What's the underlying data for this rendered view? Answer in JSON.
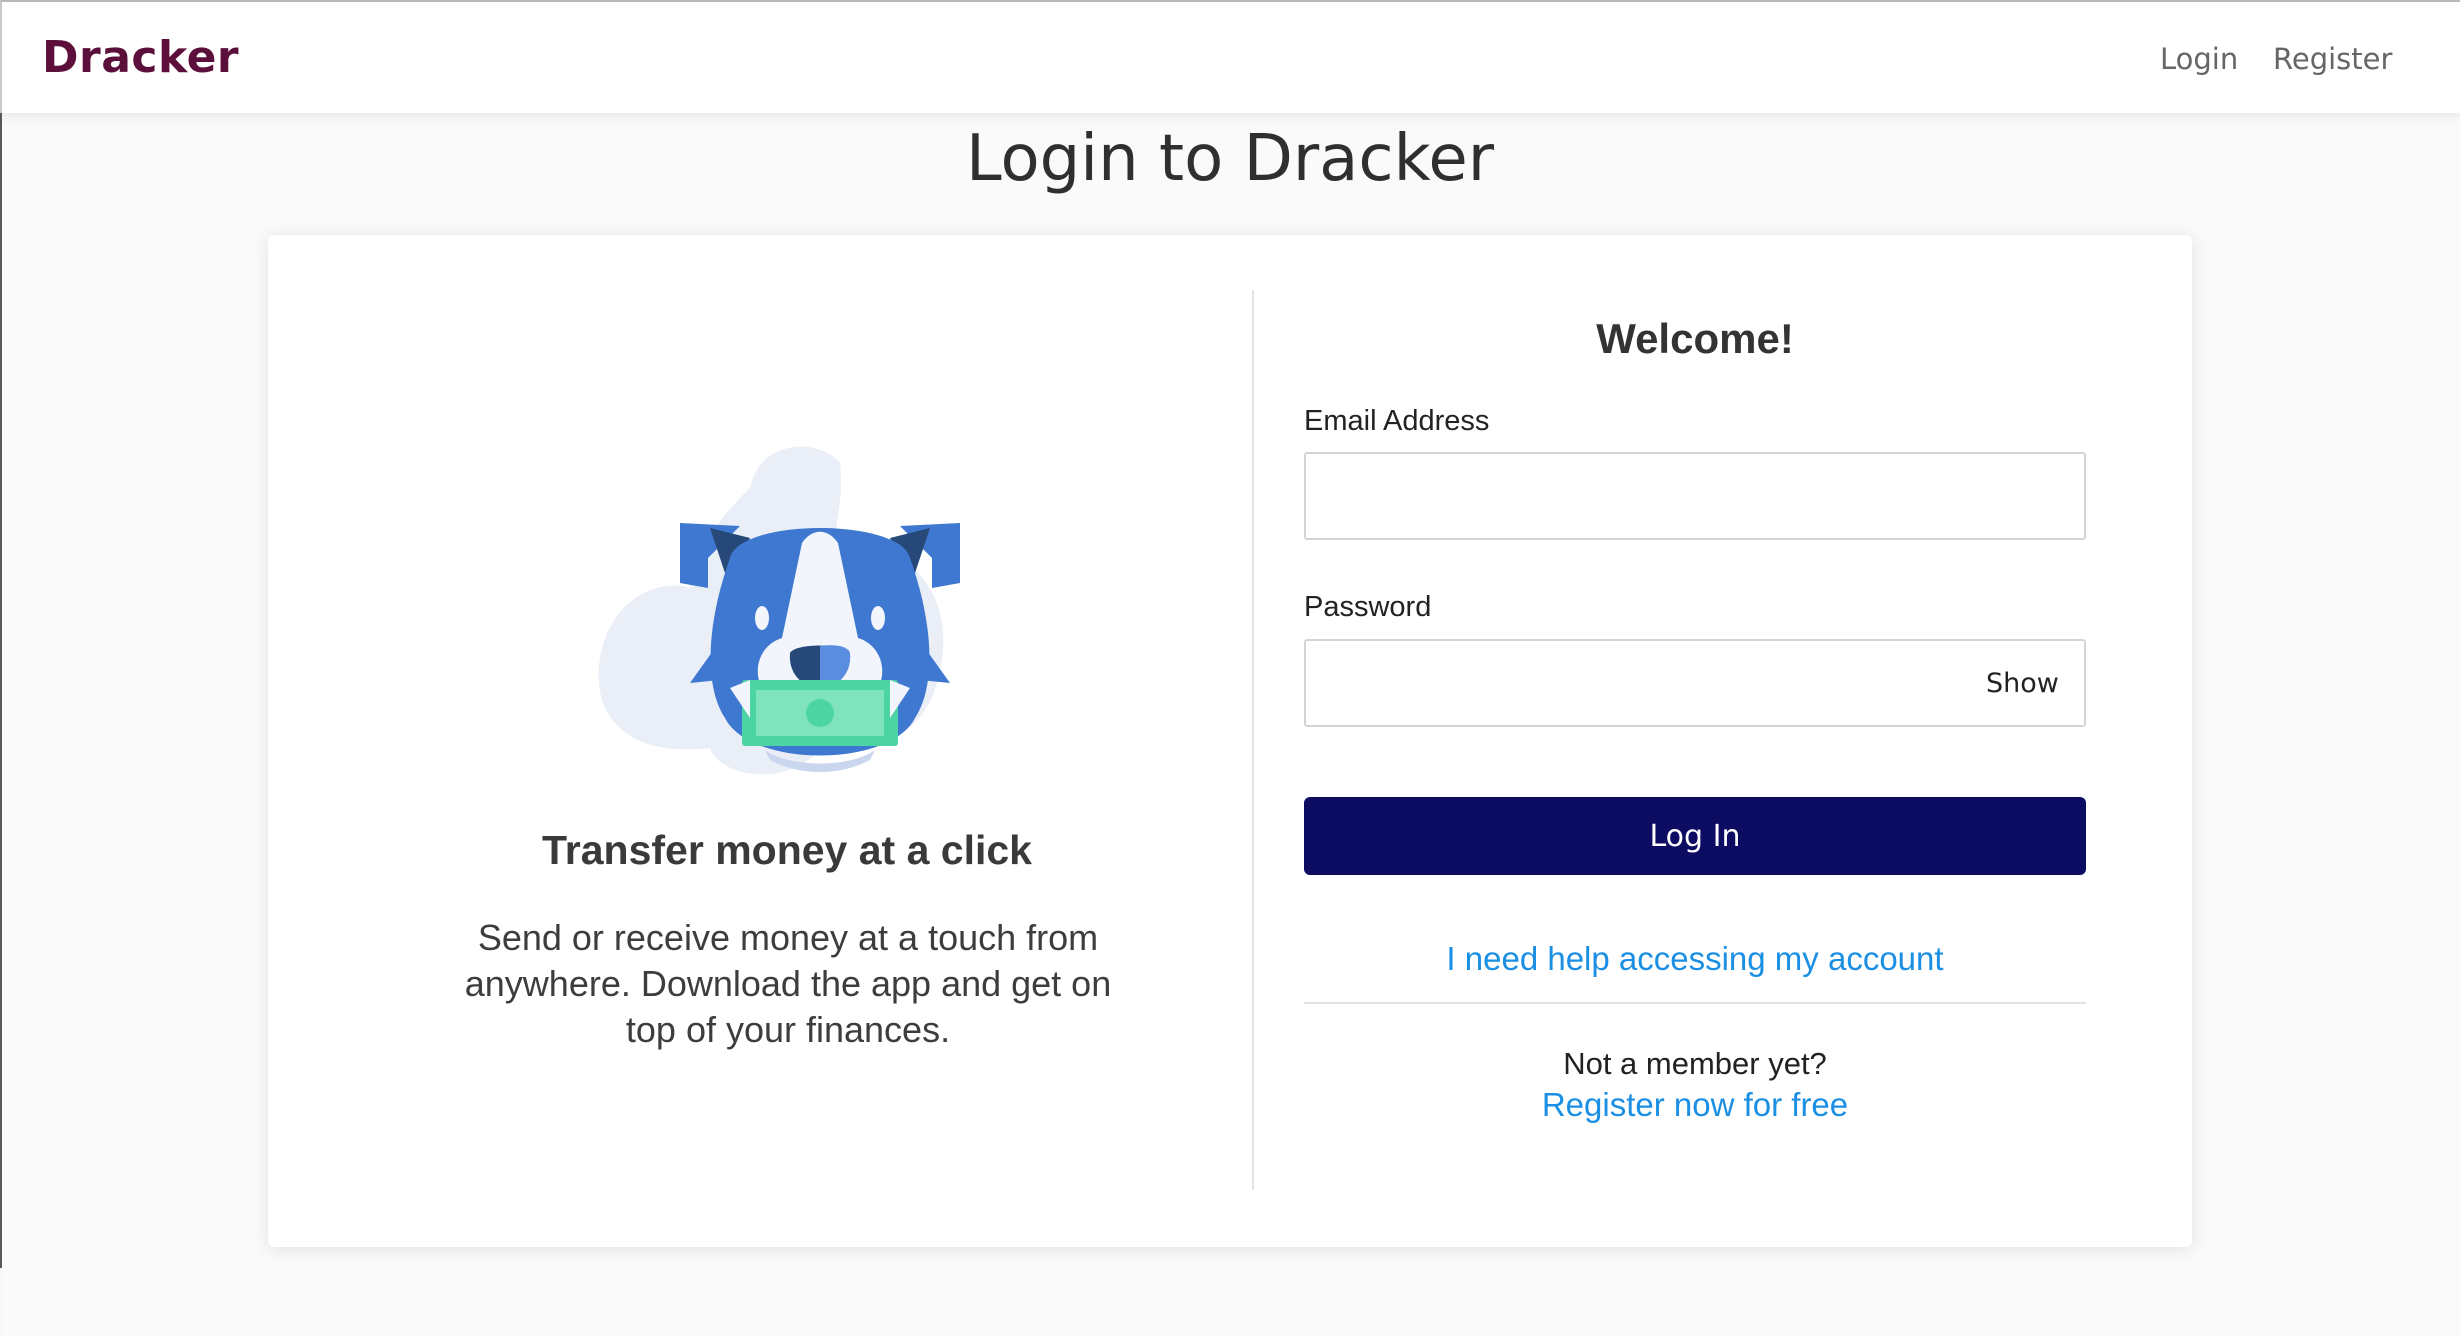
{
  "navbar": {
    "brand": "Dracker",
    "links": [
      {
        "label": "Login"
      },
      {
        "label": "Register"
      }
    ]
  },
  "page": {
    "title": "Login to Dracker"
  },
  "promo": {
    "illustration_icon": "dog-holding-money-illustration",
    "title": "Transfer money at a click",
    "text": "Send or receive money at a touch from anywhere. Download the app and get on top of your finances."
  },
  "form": {
    "welcome": "Welcome!",
    "email": {
      "label": "Email Address",
      "value": "",
      "placeholder": ""
    },
    "password": {
      "label": "Password",
      "value": "",
      "placeholder": "",
      "toggle_label": "Show"
    },
    "submit_label": "Log In",
    "help_link": "I need help accessing my account",
    "not_member": "Not a member yet?",
    "register_link": "Register now for free"
  },
  "colors": {
    "brand": "#5b0f3a",
    "primary_button": "#0c0c62",
    "link": "#1a8fe3"
  }
}
